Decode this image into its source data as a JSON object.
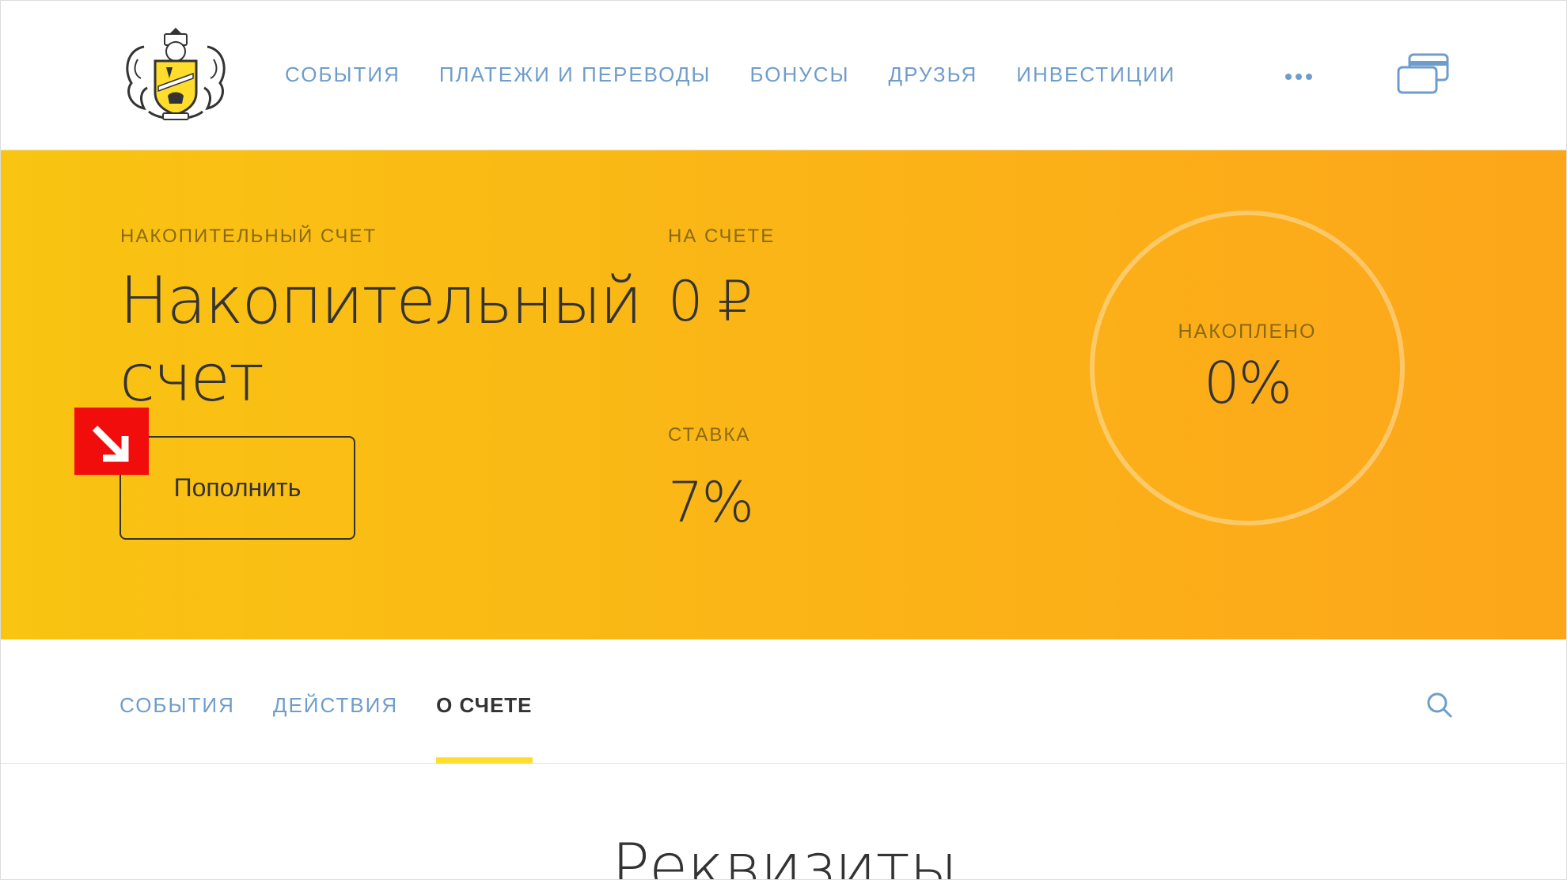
{
  "header": {
    "nav": [
      "СОБЫТИЯ",
      "ПЛАТЕЖИ И ПЕРЕВОДЫ",
      "БОНУСЫ",
      "ДРУЗЬЯ",
      "ИНВЕСТИЦИИ"
    ]
  },
  "account": {
    "type_label": "НАКОПИТЕЛЬНЫЙ СЧЕТ",
    "title": "Накопительный счет",
    "balance_label": "НА СЧЕТЕ",
    "balance": "0 ₽",
    "rate_label": "СТАВКА",
    "rate": "7%",
    "topup_label": "Пополнить",
    "accumulated_label": "НАКОПЛЕНО",
    "accumulated_value": "0%",
    "accumulated_fraction": 0
  },
  "tabs": {
    "items": [
      "СОБЫТИЯ",
      "ДЕЙСТВИЯ",
      "О СЧЕТЕ"
    ],
    "active": "О СЧЕТЕ"
  },
  "section": {
    "title": "Реквизиты"
  },
  "colors": {
    "brand_yellow": "#ffdd2d",
    "link_blue": "#6f9dcb",
    "marker_red": "#f20d0d"
  },
  "icons": {
    "logo": "tinkoff-crest-logo",
    "more": "more-dots-icon",
    "cards": "cards-icon",
    "search": "search-icon",
    "marker": "arrow-down-right-icon"
  }
}
